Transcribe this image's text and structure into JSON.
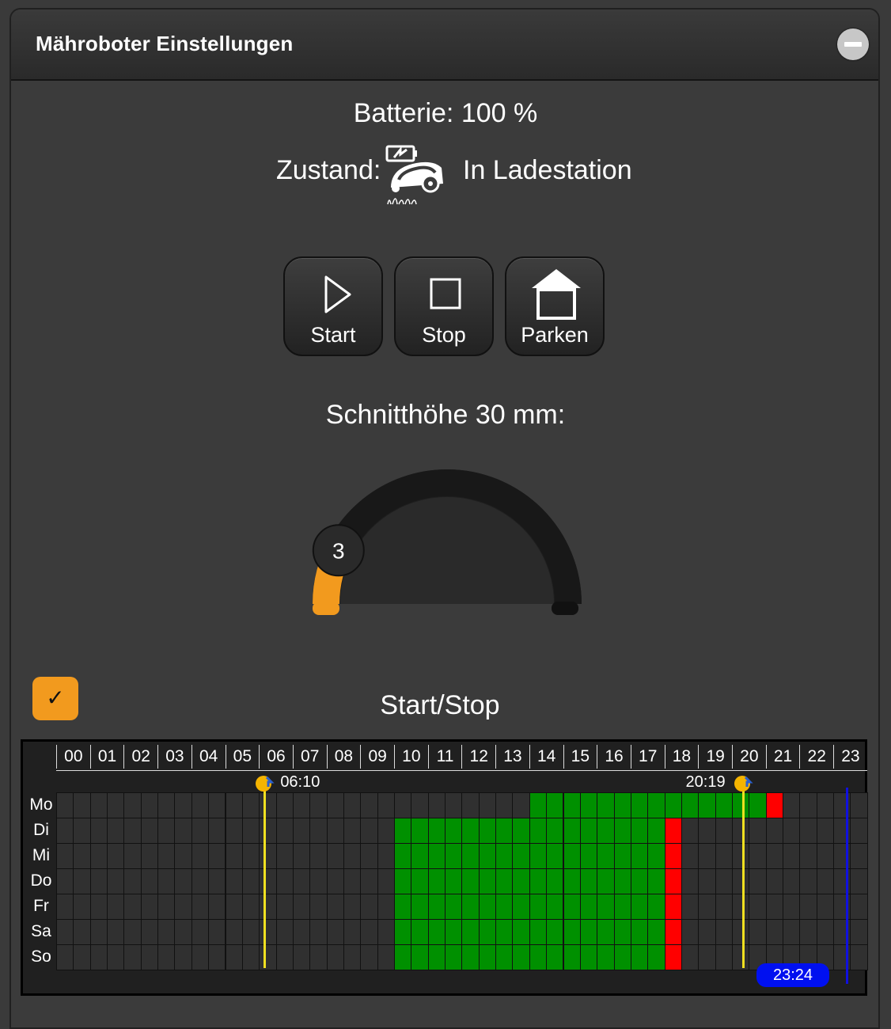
{
  "panel": {
    "title": "Mähroboter Einstellungen"
  },
  "status": {
    "battery_text": "Batterie: 100 %",
    "state_label": "Zustand:",
    "state_value": "In Ladestation",
    "state_icon": "mower-charging-icon"
  },
  "controls": {
    "start_label": "Start",
    "stop_label": "Stop",
    "park_label": "Parken"
  },
  "cutting_height": {
    "label": "Schnitthöhe 30 mm:",
    "level": 3,
    "min": 1,
    "max": 9,
    "accent": "#f29a1e"
  },
  "schedule": {
    "enabled": true,
    "checkbox_mark": "✓",
    "title": "Start/Stop",
    "hours": [
      "00",
      "01",
      "02",
      "03",
      "04",
      "05",
      "06",
      "07",
      "08",
      "09",
      "10",
      "11",
      "12",
      "13",
      "14",
      "15",
      "16",
      "17",
      "18",
      "19",
      "20",
      "21",
      "22",
      "23"
    ],
    "days": [
      {
        "label": "Mo",
        "on_from": 14,
        "on_to": 21,
        "stop_at": 21
      },
      {
        "label": "Di",
        "on_from": 10,
        "on_to": 18,
        "stop_at": 18
      },
      {
        "label": "Mi",
        "on_from": 10,
        "on_to": 18,
        "stop_at": 18
      },
      {
        "label": "Do",
        "on_from": 10,
        "on_to": 18,
        "stop_at": 18
      },
      {
        "label": "Fr",
        "on_from": 10,
        "on_to": 18,
        "stop_at": 18
      },
      {
        "label": "Sa",
        "on_from": 10,
        "on_to": 18,
        "stop_at": 18
      },
      {
        "label": "So",
        "on_from": 10,
        "on_to": 18,
        "stop_at": 18
      }
    ],
    "sunrise": "06:10",
    "sunset": "20:19",
    "now": "23:24",
    "colors": {
      "on": "#009000",
      "stop": "#ff0000",
      "sun": "#f0e020",
      "now": "#1010e0"
    }
  }
}
